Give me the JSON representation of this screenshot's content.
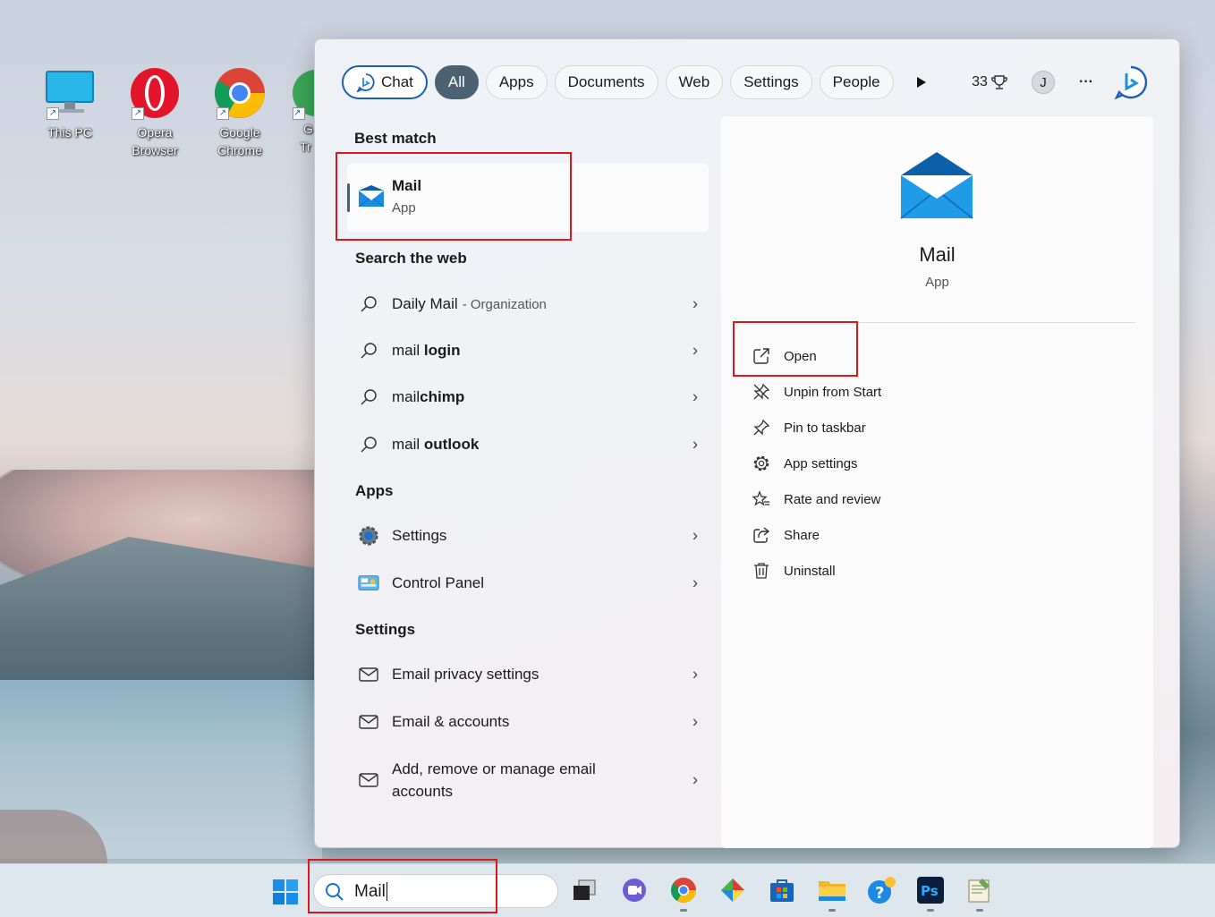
{
  "desktop": {
    "icons": [
      {
        "label1": "This PC",
        "label2": "",
        "icon": "this-pc-icon"
      },
      {
        "label1": "Opera",
        "label2": "Browser",
        "icon": "opera-icon"
      },
      {
        "label1": "Google",
        "label2": "Chrome",
        "icon": "chrome-icon"
      },
      {
        "label1": "G",
        "label2": "Tr",
        "icon": "google-translate-icon"
      }
    ]
  },
  "filters": {
    "chat": "Chat",
    "all": "All",
    "apps": "Apps",
    "documents": "Documents",
    "web": "Web",
    "settings": "Settings",
    "people": "People",
    "points": "33",
    "avatar": "J",
    "more": "···"
  },
  "best_match": {
    "heading": "Best match",
    "name": "Mail",
    "type": "App"
  },
  "web": {
    "heading": "Search the web",
    "items": [
      {
        "pre": "Daily ",
        "bold": "Mail",
        "post": "",
        "sub": "- Organization"
      },
      {
        "pre": "mail ",
        "bold": "login",
        "post": "",
        "sub": ""
      },
      {
        "pre": "mail",
        "bold": "chimp",
        "post": "",
        "sub": ""
      },
      {
        "pre": "mail ",
        "bold": "outlook",
        "post": "",
        "sub": ""
      }
    ]
  },
  "apps": {
    "heading": "Apps",
    "items": [
      {
        "label": "Settings",
        "icon": "settings-gear-icon"
      },
      {
        "label": "Control Panel",
        "icon": "control-panel-icon"
      }
    ]
  },
  "settings": {
    "heading": "Settings",
    "items": [
      {
        "label": "Email privacy settings"
      },
      {
        "label": "Email & accounts"
      },
      {
        "label1": "Add, remove or manage email",
        "label2": "accounts"
      }
    ]
  },
  "preview": {
    "name": "Mail",
    "type": "App",
    "actions": [
      {
        "label": "Open",
        "icon": "open-external-icon"
      },
      {
        "label": "Unpin from Start",
        "icon": "unpin-icon"
      },
      {
        "label": "Pin to taskbar",
        "icon": "pin-icon"
      },
      {
        "label": "App settings",
        "icon": "gear-icon"
      },
      {
        "label": "Rate and review",
        "icon": "star-icon"
      },
      {
        "label": "Share",
        "icon": "share-icon"
      },
      {
        "label": "Uninstall",
        "icon": "trash-icon"
      }
    ]
  },
  "taskbar": {
    "search_value": "Mail"
  },
  "colors": {
    "accent": "#1d5fb8",
    "highlight": "#e0161d",
    "all_pill": "#4c6273"
  }
}
